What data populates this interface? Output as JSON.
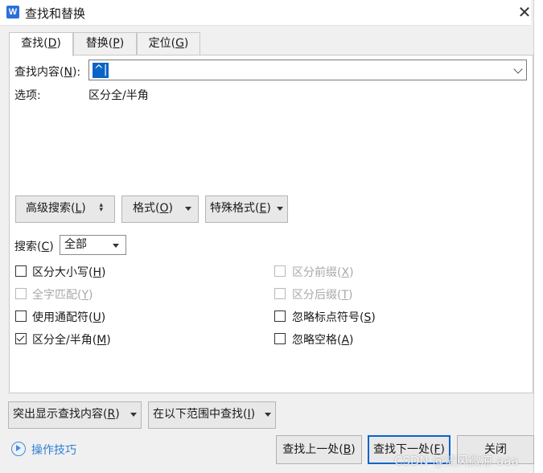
{
  "window": {
    "title": "查找和替换",
    "app_icon": "W",
    "close_glyph": "✕"
  },
  "tabs": [
    {
      "label": "查找",
      "key": "D",
      "active": true
    },
    {
      "label": "替换",
      "key": "P",
      "active": false
    },
    {
      "label": "定位",
      "key": "G",
      "active": false
    }
  ],
  "find": {
    "label": "查找内容",
    "key": "N",
    "value": "^|"
  },
  "options": {
    "label": "选项:",
    "value": "区分全/半角"
  },
  "buttons": {
    "advanced": {
      "label": "高级搜索",
      "key": "L"
    },
    "format": {
      "label": "格式",
      "key": "O"
    },
    "special": {
      "label": "特殊格式",
      "key": "E"
    }
  },
  "search_scope": {
    "label": "搜索",
    "key": "C",
    "value": "全部"
  },
  "checkboxes": [
    {
      "label": "区分大小写",
      "key": "H",
      "checked": false,
      "disabled": false
    },
    {
      "label": "全字匹配",
      "key": "Y",
      "checked": false,
      "disabled": true
    },
    {
      "label": "使用通配符",
      "key": "U",
      "checked": false,
      "disabled": false
    },
    {
      "label": "区分全/半角",
      "key": "M",
      "checked": true,
      "disabled": false
    },
    {
      "label": "区分前缀",
      "key": "X",
      "checked": false,
      "disabled": true
    },
    {
      "label": "区分后缀",
      "key": "T",
      "checked": false,
      "disabled": true
    },
    {
      "label": "忽略标点符号",
      "key": "S",
      "checked": false,
      "disabled": false
    },
    {
      "label": "忽略空格",
      "key": "A",
      "checked": false,
      "disabled": false
    }
  ],
  "highlight": {
    "label": "突出显示查找内容",
    "key": "R"
  },
  "find_in": {
    "label": "在以下范围中查找",
    "key": "I"
  },
  "help": {
    "label": "操作技巧"
  },
  "footer": {
    "prev": {
      "label": "查找上一处",
      "key": "B"
    },
    "next": {
      "label": "查找下一处",
      "key": "F"
    },
    "close": {
      "label": "关闭"
    }
  },
  "watermark": "CSDN @清风微凉 aaa",
  "colors": {
    "accent": "#0a64c8",
    "link": "#2f7fd6",
    "disabled": "#a8a8a8"
  }
}
